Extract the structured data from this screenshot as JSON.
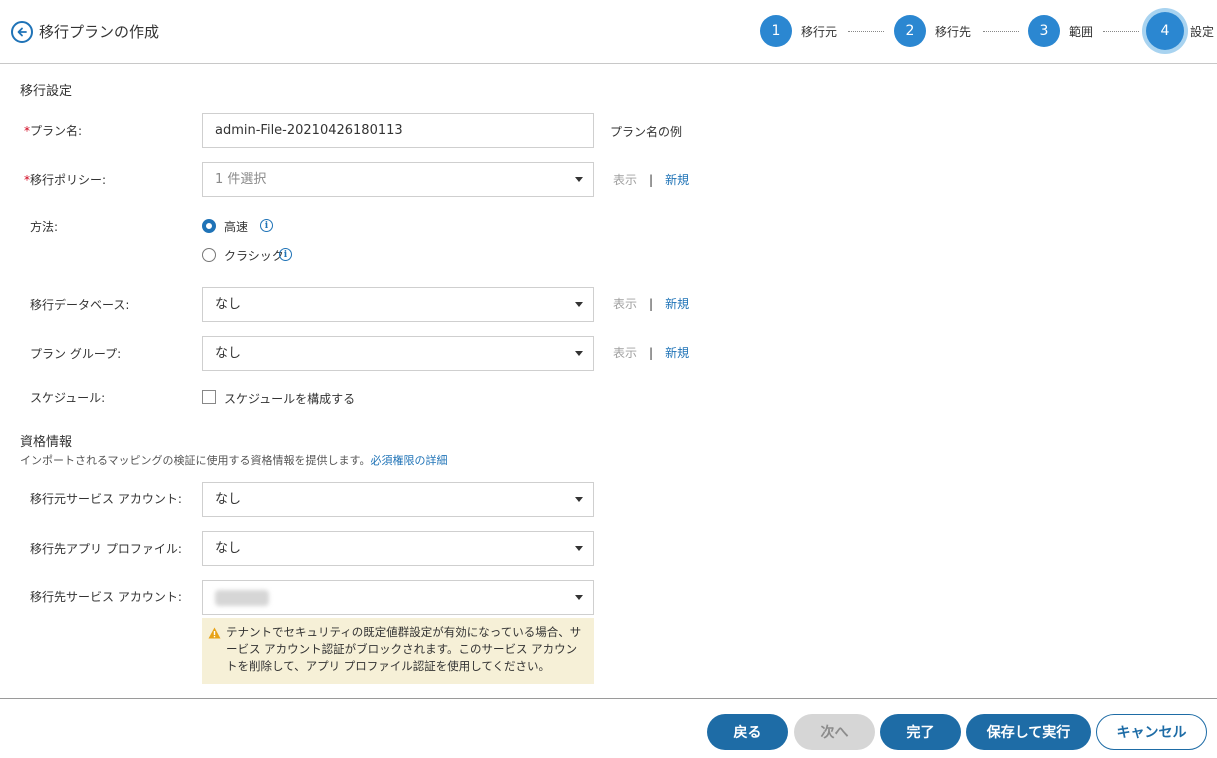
{
  "header": {
    "title": "移行プランの作成",
    "steps": [
      {
        "num": "1",
        "label": "移行元"
      },
      {
        "num": "2",
        "label": "移行先"
      },
      {
        "num": "3",
        "label": "範囲"
      },
      {
        "num": "4",
        "label": "設定"
      }
    ],
    "active_step": 4
  },
  "migration_settings": {
    "title": "移行設定",
    "plan_name": {
      "required_mark": "*",
      "label": "プラン名:",
      "value": "admin-File-20210426180113",
      "link": "プラン名の例"
    },
    "policy": {
      "required_mark": "*",
      "label": "移行ポリシー:",
      "placeholder": "1 件選択",
      "view": "表示",
      "separator": "|",
      "new": "新規"
    },
    "method": {
      "label": "方法:",
      "options": [
        {
          "label": "高速",
          "checked": true
        },
        {
          "label": "クラシック",
          "checked": false
        }
      ],
      "info_glyph": "i"
    },
    "database": {
      "label": "移行データベース:",
      "value": "なし",
      "view": "表示",
      "separator": "|",
      "new": "新規"
    },
    "plan_group": {
      "label": "プラン グループ:",
      "value": "なし",
      "view": "表示",
      "separator": "|",
      "new": "新規"
    },
    "schedule": {
      "label": "スケジュール:",
      "checkbox_label": "スケジュールを構成する",
      "checked": false
    }
  },
  "credentials": {
    "title": "資格情報",
    "description": "インポートされるマッピングの検証に使用する資格情報を提供します。",
    "description_link": "必須権限の詳細",
    "source_service_account": {
      "label": "移行元サービス アカウント:",
      "value": "なし"
    },
    "dest_app_profile": {
      "label": "移行先アプリ プロファイル:",
      "value": "なし"
    },
    "dest_service_account": {
      "label": "移行先サービス アカウント:",
      "value": ""
    },
    "warning": "テナントでセキュリティの既定値群設定が有効になっている場合、サービス アカウント認証がブロックされます。このサービス アカウントを削除して、アプリ プロファイル認証を使用してください。"
  },
  "footer": {
    "back": "戻る",
    "next": "次へ",
    "finish": "完了",
    "save_run": "保存して実行",
    "cancel": "キャンセル"
  },
  "colors": {
    "accent": "#1e6ca6",
    "step": "#2b87d1",
    "link": "#1f73b7",
    "required": "#d0021b",
    "warning_bg": "#f6f0d7",
    "warning_icon": "#e8a317"
  }
}
